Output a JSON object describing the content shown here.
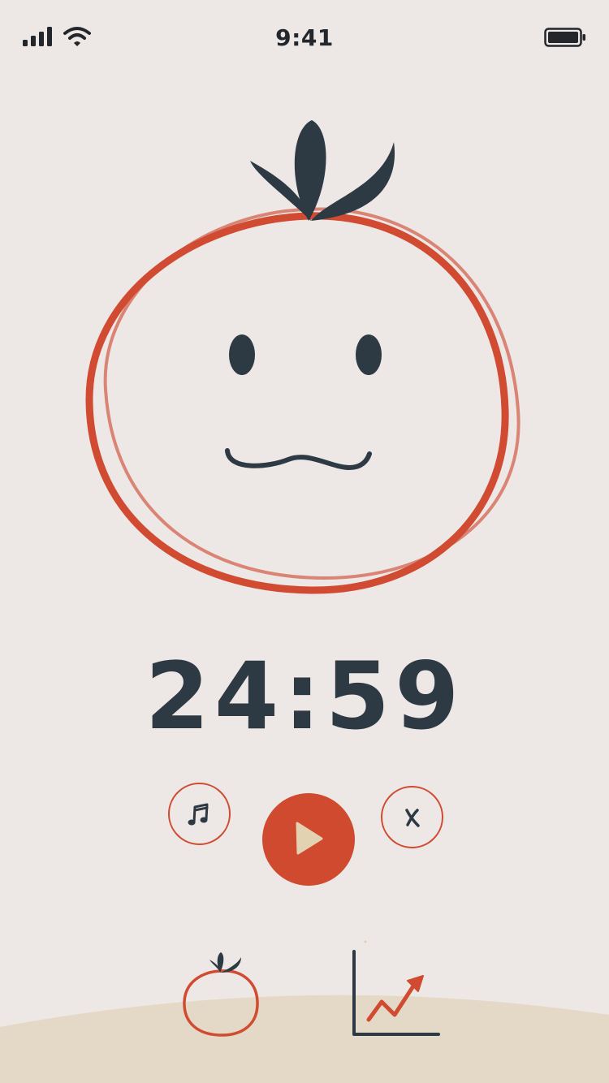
{
  "status_bar": {
    "time": "9:41",
    "signal_icon": "cellular-signal-icon",
    "wifi_icon": "wifi-icon",
    "battery_icon": "battery-icon"
  },
  "mascot": {
    "name": "tomato-mascot",
    "outline_color": "#d04b31",
    "leaf_color": "#2e3a43"
  },
  "timer": {
    "display": "24:59"
  },
  "controls": {
    "music_icon": "music-note-icon",
    "play_icon": "play-icon",
    "close_icon": "close-icon",
    "accent_color": "#cf4a2e"
  },
  "tab_bar": {
    "items": [
      {
        "icon": "tomato-icon"
      },
      {
        "icon": "stats-chart-icon"
      }
    ]
  },
  "colors": {
    "background": "#ede7e5",
    "ground": "#e4d9c6",
    "text": "#2d3a44",
    "accent": "#cf4a2e"
  }
}
